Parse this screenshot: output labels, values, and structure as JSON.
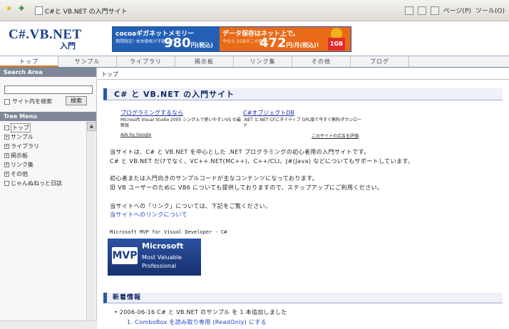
{
  "browser": {
    "tab_title": "C#と VB.NET の入門サイト",
    "toolbar": [
      "ページ(P)",
      "ツール(O)"
    ]
  },
  "header": {
    "logo_main": "C#.VB.NET",
    "logo_sub": "入門",
    "banner_left": {
      "headline": "cocoaギガネットメモリー",
      "note": "期間限定! 本体価格が半額以下!",
      "price": "980",
      "unit": "円(税込)"
    },
    "banner_right": {
      "headline": "データ保存はネット上で。",
      "note": "今なら 2GBがこの価格!",
      "price": "472",
      "unit": "円/月(税込)!"
    },
    "mascot_label": "1GB"
  },
  "nav": [
    "トップ",
    "サンプル",
    "ライブラリ",
    "掲示板",
    "リンク集",
    "その他",
    "ブログ"
  ],
  "sidebar": {
    "search_title": "Search Area",
    "search_value": "",
    "search_option": "サイト内を検索",
    "search_button": "検索",
    "tree_title": "Tree Menu",
    "tree": [
      "トップ",
      "サンプル",
      "ライブラリ",
      "掲示板",
      "リンク集",
      "その他",
      "じゃんぬねっと日誌"
    ]
  },
  "main": {
    "breadcrumb": "トップ",
    "title": "C# と VB.NET の入門サイト",
    "ads": [
      {
        "title": "プログラミングするなら",
        "desc": "Microsoft Visual Studio 2005 シングルで使いやすいVS の最新版"
      },
      {
        "title": "C#オブジェクトDB",
        "desc": ".NET と.NET CFにネイティブ GPL版で今すぐ無料ダウンロード"
      }
    ],
    "ads_by": "Ads by Google",
    "ads_feedback": "このサイトの広告を評価",
    "intro1": "当サイトは、C# と VB.NET を中心とした .NET プログラミングの初心者用の入門サイトです。",
    "intro2": "C# と VB.NET だけでなく、VC++.NET(MC++)、C++/CLI、J#(Java) などについてもサポートしています。",
    "intro3": "初心者または入門向きのサンプルコードが主なコンテンツになっております。",
    "intro4": "旧 VB ユーザーのために VB6 についても提供しておりますので、ステップアップにご利用ください。",
    "link_note": "当サイトへの「リンク」については、下記をご覧ください。",
    "link_text": "当サイトへのリンクについて",
    "mvp_label": "Microsoft MVP for Visual Developer - C#",
    "mvp": {
      "badge": "MVP",
      "line1": "Microsoft",
      "line2": "Most Valuable",
      "line3": "Professional"
    },
    "news_title": "新着情報",
    "news_item": "2006-06-16  C# と VB.NET のサンプル を 1 本追加しました",
    "news_sub": "1. ComboBox を読み取り専用 (ReadOnly) にする"
  }
}
